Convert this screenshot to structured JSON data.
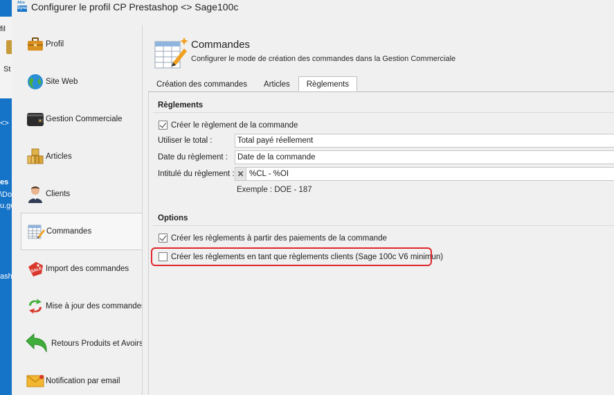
{
  "window": {
    "title": "Configurer le profil CP Prestashop <> Sage100c",
    "logo_top": "Alco",
    "logo_bottom": "Sync"
  },
  "background_app": {
    "fragments": [
      "fil",
      "St",
      "<>",
      "es",
      "\\Do",
      "u.go",
      "ash"
    ]
  },
  "nav": {
    "items": [
      {
        "label": "Profil",
        "icon": "briefcase-icon"
      },
      {
        "label": "Site Web",
        "icon": "globe-icon"
      },
      {
        "label": "Gestion Commerciale",
        "icon": "wallet-icon"
      },
      {
        "label": "Articles",
        "icon": "boxes-icon"
      },
      {
        "label": "Clients",
        "icon": "person-icon"
      },
      {
        "label": "Commandes",
        "icon": "order-sheet-icon",
        "active": true
      },
      {
        "label": "Import des commandes",
        "icon": "sale-tag-icon"
      },
      {
        "label": "Mise à jour des commandes",
        "icon": "refresh-arrows-icon"
      },
      {
        "label": "Retours Produits et Avoirs",
        "icon": "return-arrow-icon"
      },
      {
        "label": "Notification par email",
        "icon": "envelope-icon"
      }
    ]
  },
  "header": {
    "title": "Commandes",
    "subtitle": "Configurer le mode de création des commandes dans la Gestion Commerciale"
  },
  "tabs": [
    {
      "label": "Création des commandes"
    },
    {
      "label": "Articles"
    },
    {
      "label": "Règlements",
      "active": true
    }
  ],
  "reglements": {
    "section_title": "Règlements",
    "create_payment_label": "Créer le règlement de la commande",
    "create_payment_checked": true,
    "use_total_label": "Utiliser le total :",
    "use_total_value": "Total payé réellement",
    "payment_date_label": "Date du règlement :",
    "payment_date_value": "Date de la commande",
    "payment_title_label": "Intitulé du règlement :",
    "payment_title_value": "%CL - %OI",
    "clear_symbol": "✕",
    "example": "Exemple : DOE - 187"
  },
  "options": {
    "section_title": "Options",
    "from_payments_label": "Créer les règlements à partir des paiements de la commande",
    "from_payments_checked": true,
    "as_client_payments_label": "Créer les règlements en tant que règlements clients (Sage 100c V6 minimun)",
    "as_client_payments_checked": false
  },
  "colors": {
    "highlight": "#e0252b",
    "background_app_blue": "#1573c8"
  }
}
